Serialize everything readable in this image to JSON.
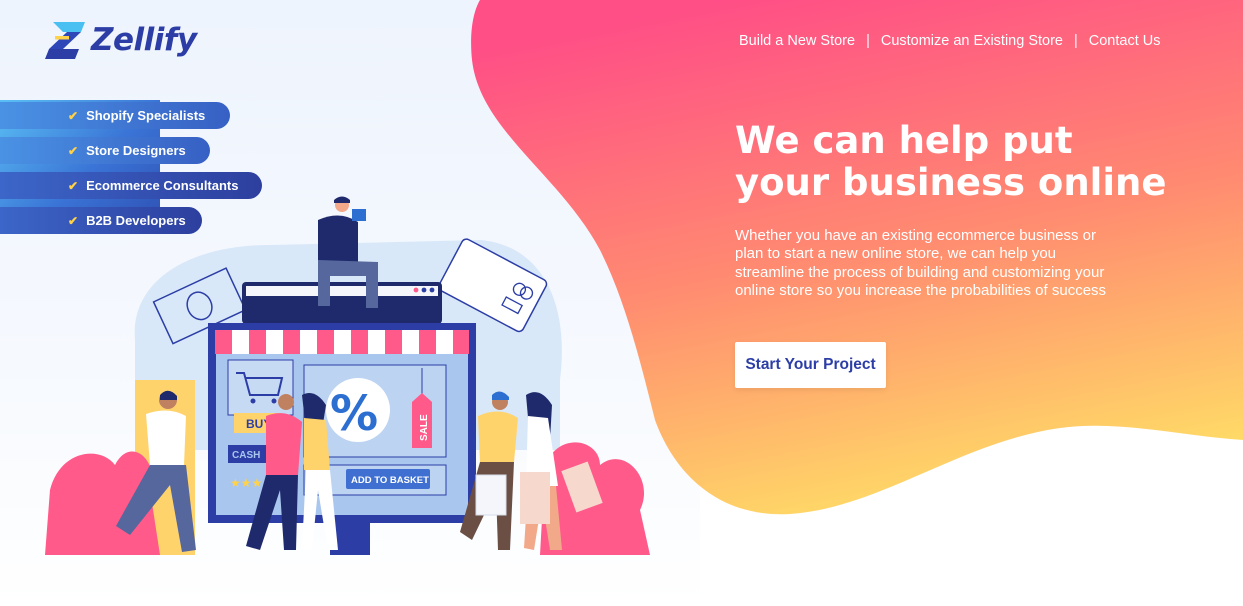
{
  "brand": {
    "name": "Zellify",
    "logo_icon": "z-logo-icon"
  },
  "nav": {
    "items": [
      "Build a New Store",
      "Customize an Existing Store",
      "Contact Us"
    ],
    "separator": "|"
  },
  "specialties": [
    "Shopify Specialists",
    "Store Designers",
    "Ecommerce Consultants",
    "B2B Developers"
  ],
  "check_symbol": "✔",
  "hero": {
    "title_line1": "We can help put",
    "title_line2": "your business online",
    "description": "Whether you have an existing ecommerce business or plan to start a new online store, we can help you streamline the process of building and customizing your online store so you increase the probabilities of success",
    "cta_label": "Start Your Project"
  },
  "illustration": {
    "buy_label": "BUY",
    "cash_label": "CASH",
    "percent_label": "%",
    "sale_label": "SALE",
    "basket_label": "ADD TO BASKET"
  },
  "colors": {
    "brand_blue": "#2c3ea6",
    "gradient_pink": "#ff4f86",
    "gradient_coral": "#ff8c70",
    "gradient_yellow": "#ffe066"
  }
}
